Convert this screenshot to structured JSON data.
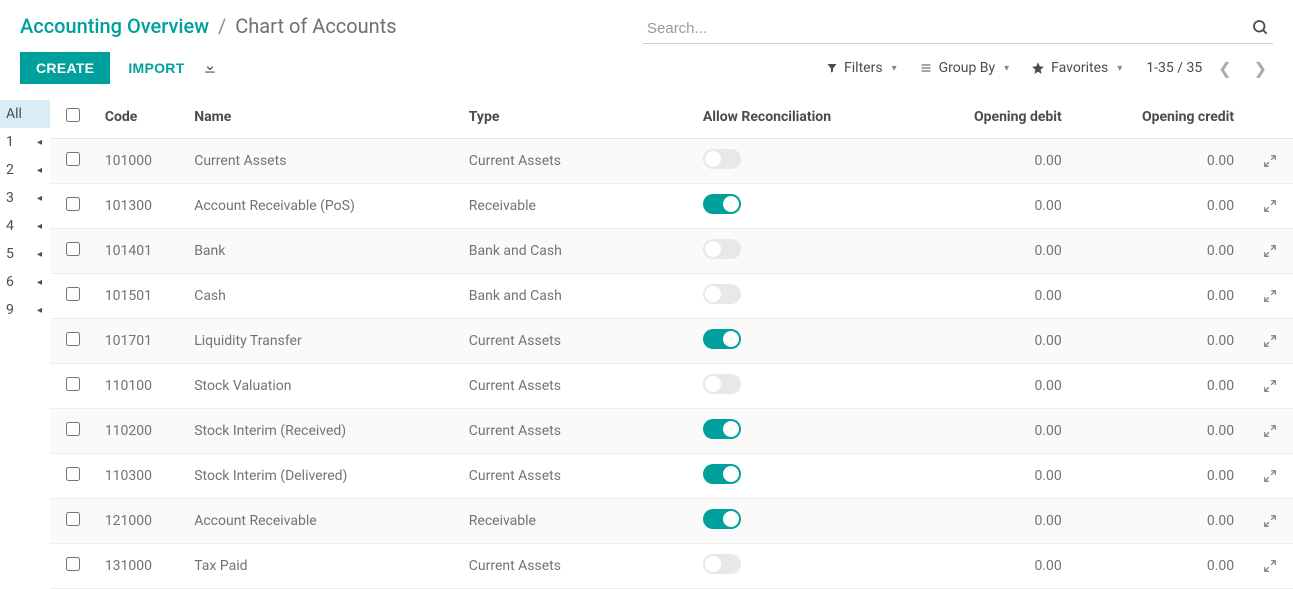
{
  "breadcrumb": {
    "parent": "Accounting Overview",
    "current": "Chart of Accounts"
  },
  "search": {
    "placeholder": "Search..."
  },
  "buttons": {
    "create": "CREATE",
    "import": "IMPORT"
  },
  "filters": {
    "filters_label": "Filters",
    "groupby_label": "Group By",
    "favorites_label": "Favorites"
  },
  "pager": {
    "text": "1-35 / 35"
  },
  "sidebar": {
    "items": [
      {
        "label": "All",
        "active": true
      },
      {
        "label": "1",
        "active": false
      },
      {
        "label": "2",
        "active": false
      },
      {
        "label": "3",
        "active": false
      },
      {
        "label": "4",
        "active": false
      },
      {
        "label": "5",
        "active": false
      },
      {
        "label": "6",
        "active": false
      },
      {
        "label": "9",
        "active": false
      }
    ]
  },
  "table": {
    "headers": {
      "code": "Code",
      "name": "Name",
      "type": "Type",
      "reconciliation": "Allow Reconciliation",
      "opening_debit": "Opening debit",
      "opening_credit": "Opening credit"
    },
    "rows": [
      {
        "code": "101000",
        "name": "Current Assets",
        "type": "Current Assets",
        "reconcile": false,
        "debit": "0.00",
        "credit": "0.00"
      },
      {
        "code": "101300",
        "name": "Account Receivable (PoS)",
        "type": "Receivable",
        "reconcile": true,
        "debit": "0.00",
        "credit": "0.00"
      },
      {
        "code": "101401",
        "name": "Bank",
        "type": "Bank and Cash",
        "reconcile": false,
        "debit": "0.00",
        "credit": "0.00"
      },
      {
        "code": "101501",
        "name": "Cash",
        "type": "Bank and Cash",
        "reconcile": false,
        "debit": "0.00",
        "credit": "0.00"
      },
      {
        "code": "101701",
        "name": "Liquidity Transfer",
        "type": "Current Assets",
        "reconcile": true,
        "debit": "0.00",
        "credit": "0.00"
      },
      {
        "code": "110100",
        "name": "Stock Valuation",
        "type": "Current Assets",
        "reconcile": false,
        "debit": "0.00",
        "credit": "0.00"
      },
      {
        "code": "110200",
        "name": "Stock Interim (Received)",
        "type": "Current Assets",
        "reconcile": true,
        "debit": "0.00",
        "credit": "0.00"
      },
      {
        "code": "110300",
        "name": "Stock Interim (Delivered)",
        "type": "Current Assets",
        "reconcile": true,
        "debit": "0.00",
        "credit": "0.00"
      },
      {
        "code": "121000",
        "name": "Account Receivable",
        "type": "Receivable",
        "reconcile": true,
        "debit": "0.00",
        "credit": "0.00"
      },
      {
        "code": "131000",
        "name": "Tax Paid",
        "type": "Current Assets",
        "reconcile": false,
        "debit": "0.00",
        "credit": "0.00"
      }
    ]
  }
}
